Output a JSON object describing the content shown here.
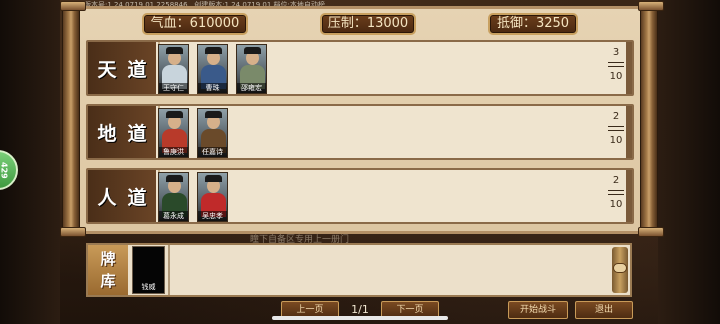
{
  "version_text": "版本号:1.24.0719.01.2258846...创建版本:1.24.0719.01 档位:本地自动榜",
  "side_badge": "429",
  "stats": {
    "hp": "气血：610000",
    "suppress": "压制：13000",
    "defense": "抵御：3250"
  },
  "rows": [
    {
      "label": [
        "天",
        "道"
      ],
      "count_current": "3",
      "count_max": "10",
      "heroes": [
        {
          "name": "王守仁",
          "coat": "#c8d4dc"
        },
        {
          "name": "曹珠",
          "coat": "#3a5a8a"
        },
        {
          "name": "邵雍宏",
          "coat": "#7a8a6a"
        }
      ]
    },
    {
      "label": [
        "地",
        "道"
      ],
      "count_current": "2",
      "count_max": "10",
      "heroes": [
        {
          "name": "鲁庚洪",
          "coat": "#b83a2a"
        },
        {
          "name": "任嘉诗",
          "coat": "#6a4a2a"
        }
      ]
    },
    {
      "label": [
        "人",
        "道"
      ],
      "count_current": "2",
      "count_max": "10",
      "heroes": [
        {
          "name": "葛永成",
          "coat": "#2a4a2a"
        },
        {
          "name": "吴忠孝",
          "coat": "#c02a2a"
        }
      ]
    }
  ],
  "below_hint": "瞳下自备区专用上一册门",
  "bank": {
    "label": [
      "牌",
      "库"
    ],
    "cards": [
      {
        "name": "钱威"
      }
    ]
  },
  "pager": {
    "prev": "上一页",
    "page": "1/1",
    "next": "下一页"
  },
  "actions": {
    "start": "开始战斗",
    "exit": "退出"
  }
}
